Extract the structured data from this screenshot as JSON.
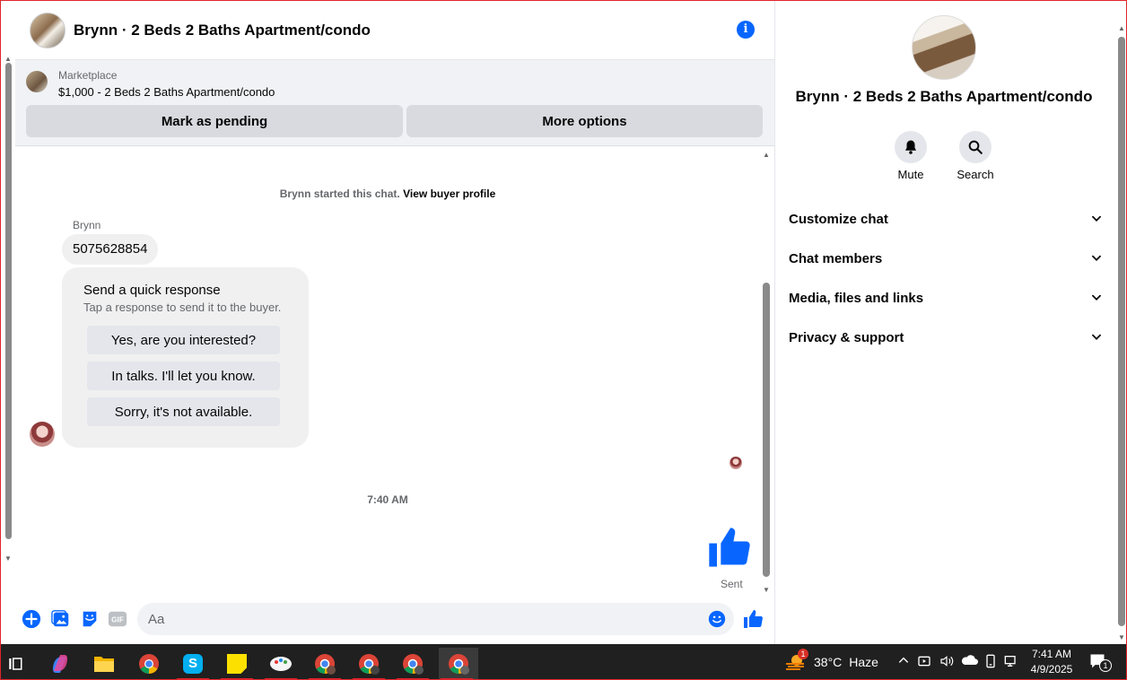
{
  "header": {
    "title": "Brynn · 2 Beds 2 Baths Apartment/condo"
  },
  "listing": {
    "source": "Marketplace",
    "summary": "$1,000 - 2 Beds 2 Baths Apartment/condo",
    "mark_pending_label": "Mark as pending",
    "more_options_label": "More options"
  },
  "conversation": {
    "started_text": "Brynn started this chat.",
    "view_profile_link": "View buyer profile",
    "sender_name": "Brynn",
    "phone_message": "5075628854",
    "quick_response": {
      "title": "Send a quick response",
      "subtitle": "Tap a response to send it to the buyer.",
      "options": [
        "Yes, are you interested?",
        "In talks. I'll let you know.",
        "Sorry, it's not available."
      ]
    },
    "timestamp": "7:40 AM",
    "sent_status": "Sent"
  },
  "composer": {
    "placeholder": "Aa",
    "icons": [
      "plus-icon",
      "photo-icon",
      "sticker-icon",
      "gif-icon",
      "emoji-icon",
      "thumbs-up-icon"
    ],
    "gif_label": "GIF"
  },
  "details": {
    "name": "Brynn · 2 Beds 2 Baths Apartment/condo",
    "actions": [
      {
        "label": "Mute",
        "icon": "bell-icon"
      },
      {
        "label": "Search",
        "icon": "search-icon"
      }
    ],
    "sections": [
      "Customize chat",
      "Chat members",
      "Media, files and links",
      "Privacy & support"
    ]
  },
  "taskbar": {
    "weather_temp": "38°C",
    "weather_condition": "Haze",
    "weather_badge": "1",
    "time": "7:41 AM",
    "date": "4/9/2025",
    "notification_count": "1",
    "apps": [
      "task-view",
      "copilot",
      "file-explorer",
      "chrome",
      "skype",
      "sticky-notes",
      "paint",
      "chrome-profile-1",
      "chrome-profile-2",
      "chrome-profile-3",
      "chrome-profile-4"
    ]
  },
  "colors": {
    "accent": "#0866ff",
    "secondary_text": "#65676b",
    "bubble": "#f0f0f0",
    "button": "#d8dadf",
    "taskbar": "#202020"
  }
}
